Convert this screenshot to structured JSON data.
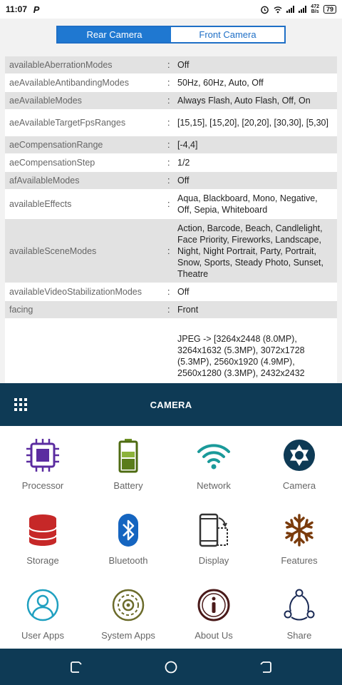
{
  "status_bar": {
    "time": "11:07",
    "app_icon": "P",
    "net_speed_value": "472",
    "net_speed_unit": "B/s",
    "battery": "79"
  },
  "camera_toggle": {
    "rear": "Rear Camera",
    "front": "Front Camera",
    "selected": "rear"
  },
  "properties": [
    {
      "key": "availableAberrationModes",
      "value": "Off"
    },
    {
      "key": "aeAvailableAntibandingModes",
      "value": "50Hz, 60Hz, Auto, Off"
    },
    {
      "key": "aeAvailableModes",
      "value": "Always Flash, Auto Flash, Off, On"
    },
    {
      "key": "aeAvailableTargetFpsRanges",
      "value": "[15,15], [15,20], [20,20], [30,30], [5,30]"
    },
    {
      "key": "aeCompensationRange",
      "value": "[-4,4]"
    },
    {
      "key": "aeCompensationStep",
      "value": "1/2"
    },
    {
      "key": "afAvailableModes",
      "value": "Off"
    },
    {
      "key": "availableEffects",
      "value": "Aqua, Blackboard, Mono, Negative, Off, Sepia, Whiteboard"
    },
    {
      "key": "availableSceneModes",
      "value": "Action, Barcode, Beach, Candlelight, Face Priority, Fireworks, Landscape, Night, Night Portrait, Party, Portrait, Snow, Sports, Steady Photo, Sunset, Theatre"
    },
    {
      "key": "availableVideoStabilizationModes",
      "value": "Off"
    },
    {
      "key": "facing",
      "value": "Front"
    },
    {
      "key": "",
      "value": "JPEG -> [3264x2448 (8.0MP), 3264x1632 (5.3MP), 3072x1728 (5.3MP), 2560x1920 (4.9MP), 2560x1280 (3.3MP), 2432x2432"
    }
  ],
  "separator": ":",
  "header": {
    "title": "CAMERA",
    "menu_icon": "grid-icon"
  },
  "menu_items": [
    {
      "label": "Processor",
      "icon": "processor-icon",
      "color": "#5b2ca0"
    },
    {
      "label": "Battery",
      "icon": "battery-icon",
      "color": "#5a7d1a"
    },
    {
      "label": "Network",
      "icon": "wifi-icon",
      "color": "#1a9a9a"
    },
    {
      "label": "Camera",
      "icon": "camera-aperture-icon",
      "color": "#0e3a55"
    },
    {
      "label": "Storage",
      "icon": "storage-icon",
      "color": "#c62828"
    },
    {
      "label": "Bluetooth",
      "icon": "bluetooth-icon",
      "color": "#1565c0"
    },
    {
      "label": "Display",
      "icon": "display-icon",
      "color": "#333333"
    },
    {
      "label": "Features",
      "icon": "snowflake-icon",
      "color": "#7a3b0c"
    },
    {
      "label": "User Apps",
      "icon": "user-apps-icon",
      "color": "#1fa0c0"
    },
    {
      "label": "System Apps",
      "icon": "system-apps-icon",
      "color": "#6b6b2a"
    },
    {
      "label": "About Us",
      "icon": "info-icon",
      "color": "#4a1a1a"
    },
    {
      "label": "Share",
      "icon": "share-icon",
      "color": "#1a2a55"
    }
  ],
  "colors": {
    "accent": "#1f78d1",
    "header_bg": "#0e3a55",
    "row_shade": "#e2e2e2"
  }
}
